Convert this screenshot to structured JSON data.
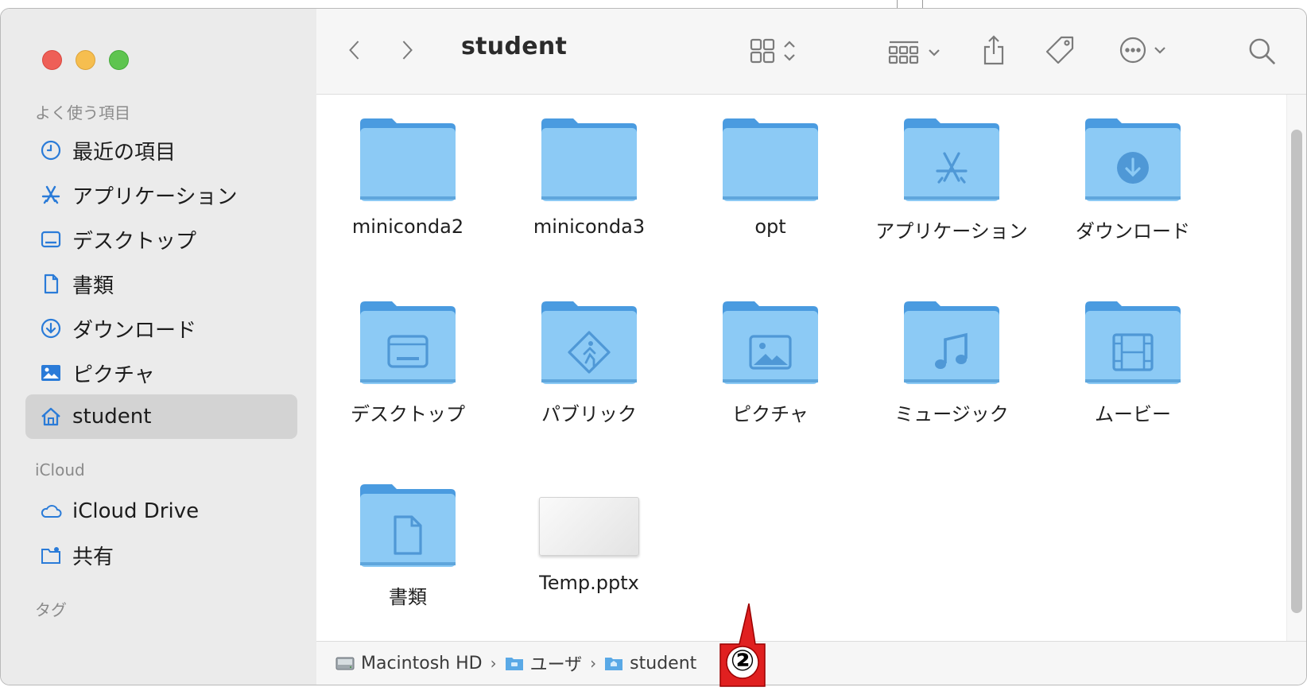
{
  "window": {
    "title": "student",
    "traffic_lights": [
      "close",
      "minimize",
      "zoom"
    ]
  },
  "sidebar": {
    "favorites_title": "よく使う項目",
    "favorites": [
      {
        "label": "最近の項目",
        "icon": "clock-icon"
      },
      {
        "label": "アプリケーション",
        "icon": "apps-icon"
      },
      {
        "label": "デスクトップ",
        "icon": "desktop-icon"
      },
      {
        "label": "書類",
        "icon": "document-icon"
      },
      {
        "label": "ダウンロード",
        "icon": "download-icon"
      },
      {
        "label": "ピクチャ",
        "icon": "picture-icon"
      },
      {
        "label": "student",
        "icon": "home-icon",
        "selected": true
      }
    ],
    "icloud_title": "iCloud",
    "icloud": [
      {
        "label": "iCloud Drive",
        "icon": "cloud-icon"
      },
      {
        "label": "共有",
        "icon": "shared-folder-icon"
      }
    ],
    "tags_title": "タグ"
  },
  "toolbar": {
    "back_icon": "chevron-left-icon",
    "forward_icon": "chevron-right-icon",
    "view_icon": "grid-view-icon",
    "group_icon": "group-icon",
    "share_icon": "share-icon",
    "tag_icon": "tag-icon",
    "more_icon": "more-icon",
    "search_icon": "search-icon"
  },
  "files": [
    {
      "name": "miniconda2",
      "kind": "folder",
      "glyph": "none"
    },
    {
      "name": "miniconda3",
      "kind": "folder",
      "glyph": "none"
    },
    {
      "name": "opt",
      "kind": "folder",
      "glyph": "none"
    },
    {
      "name": "アプリケーション",
      "kind": "folder",
      "glyph": "apps"
    },
    {
      "name": "ダウンロード",
      "kind": "folder",
      "glyph": "download"
    },
    {
      "name": "デスクトップ",
      "kind": "folder",
      "glyph": "desktop"
    },
    {
      "name": "パブリック",
      "kind": "folder",
      "glyph": "public"
    },
    {
      "name": "ピクチャ",
      "kind": "folder",
      "glyph": "picture"
    },
    {
      "name": "ミュージック",
      "kind": "folder",
      "glyph": "music"
    },
    {
      "name": "ムービー",
      "kind": "folder",
      "glyph": "movie"
    },
    {
      "name": "書類",
      "kind": "folder",
      "glyph": "document"
    },
    {
      "name": "Temp.pptx",
      "kind": "file",
      "glyph": "pptx"
    }
  ],
  "pathbar": {
    "crumbs": [
      "Macintosh HD",
      "ユーザ",
      "student"
    ],
    "separator": "›"
  },
  "annotation": {
    "marker": "②",
    "color": "#e02020"
  },
  "colors": {
    "folder_front": "#8ccaf5",
    "folder_back": "#4a9be0",
    "glyph": "#4f98d6",
    "sidebar_accent": "#2a7bd8"
  }
}
